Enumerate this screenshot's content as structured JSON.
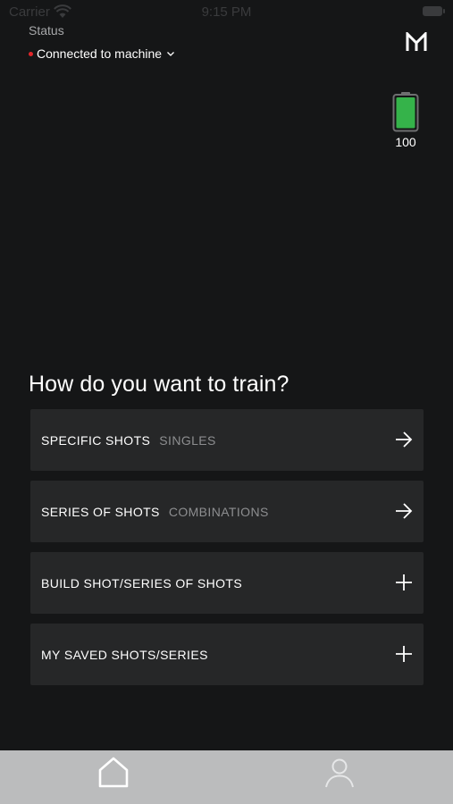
{
  "statusbar": {
    "carrier": "Carrier",
    "time": "9:15 PM"
  },
  "header": {
    "status_label": "Status",
    "connection_text": "Connected to machine",
    "logo_icon": "m-logo-icon"
  },
  "device": {
    "battery_level": "100",
    "battery_fraction": 1.0,
    "battery_color": "#35b34a"
  },
  "training": {
    "title": "How do you want to train?",
    "options": [
      {
        "label": "SPECIFIC SHOTS",
        "sublabel": "SINGLES",
        "icon": "arrow-right-icon"
      },
      {
        "label": "SERIES OF SHOTS",
        "sublabel": "COMBINATIONS",
        "icon": "arrow-right-icon"
      },
      {
        "label": "BUILD SHOT/SERIES OF SHOTS",
        "sublabel": "",
        "icon": "plus-icon"
      },
      {
        "label": "MY SAVED SHOTS/SERIES",
        "sublabel": "",
        "icon": "plus-icon"
      }
    ]
  },
  "tabbar": {
    "tabs": [
      {
        "name": "home",
        "icon": "home-icon"
      },
      {
        "name": "profile",
        "icon": "person-icon"
      }
    ]
  },
  "colors": {
    "background": "#151617",
    "card": "#262728",
    "status_dot": "#e2262a",
    "tabbar": "#bbbcbd"
  }
}
